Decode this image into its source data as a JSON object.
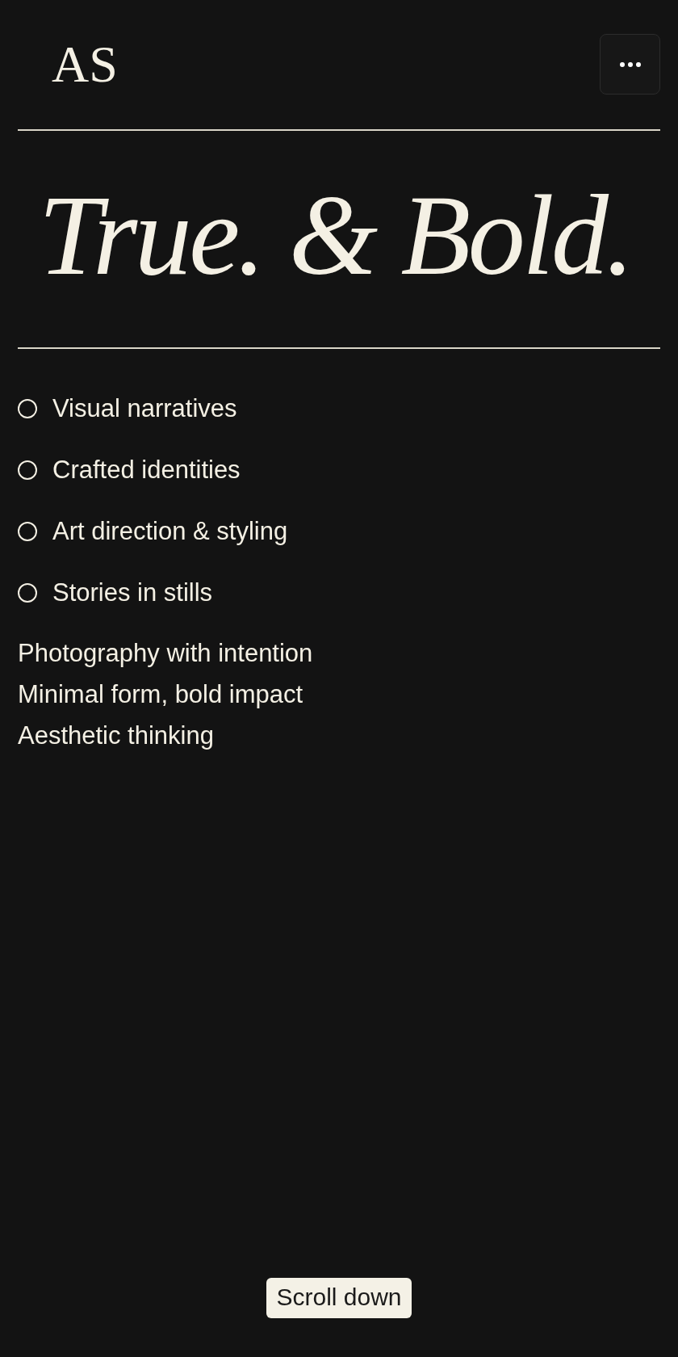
{
  "header": {
    "logo": "AS"
  },
  "headline": "True. & Bold.",
  "services": [
    "Visual narratives",
    "Crafted identities",
    "Art direction & styling",
    "Stories in stills"
  ],
  "taglines": [
    "Photography with intention",
    "Minimal form, bold impact",
    "Aesthetic thinking"
  ],
  "scroll_button": {
    "label": "Scroll down"
  }
}
